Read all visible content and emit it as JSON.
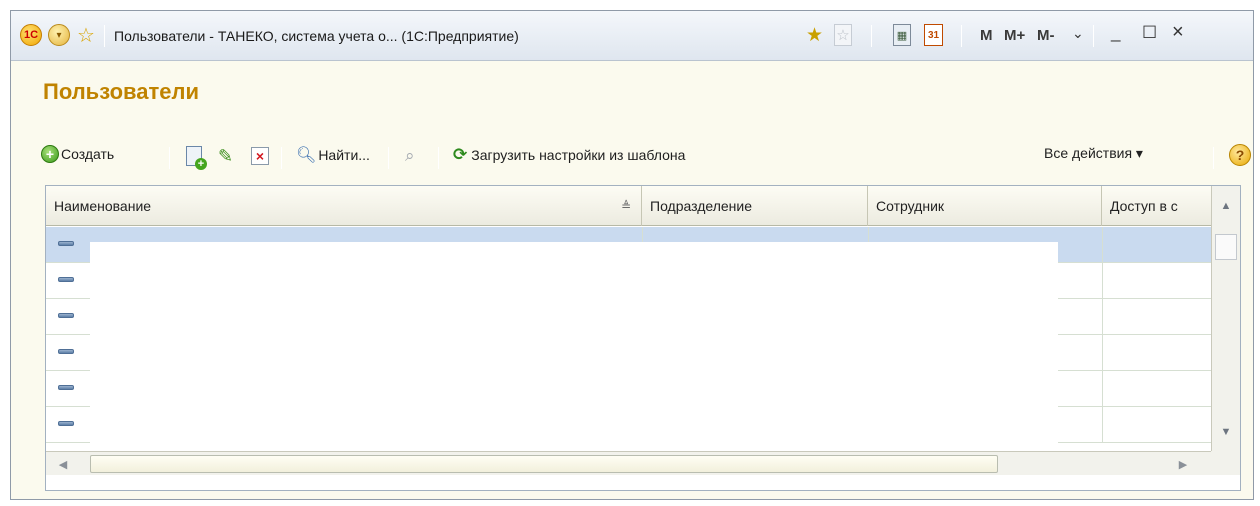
{
  "window": {
    "title": "Пользователи - ТАНЕКО, система учета о... (1С:Предприятие)",
    "logo_text": "1С",
    "toolbar_icons": {
      "calendar_day": "31",
      "memory": [
        "M",
        "M+",
        "M-"
      ]
    }
  },
  "form": {
    "title": "Пользователи",
    "toolbar": {
      "create": "Создать",
      "find": "Найти...",
      "load_settings": "Загрузить настройки из шаблона",
      "all_actions": "Все действия ▾",
      "help": "?"
    }
  },
  "table": {
    "columns": [
      "Наименование",
      "Подразделение",
      "Сотрудник",
      "Доступ в с"
    ],
    "row_count_visible": 6,
    "selected_row": 0
  },
  "colors": {
    "title_accent": "#c08300",
    "selection": "#c9daef"
  }
}
